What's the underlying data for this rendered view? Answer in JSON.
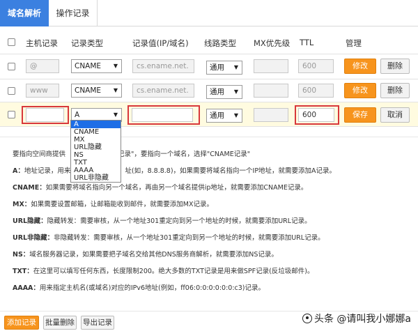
{
  "tabs": [
    {
      "label": "域名解析",
      "active": true
    },
    {
      "label": "操作记录",
      "active": false
    }
  ],
  "columns": {
    "host": "主机记录",
    "type": "记录类型",
    "value": "记录值(IP/域名)",
    "line": "线路类型",
    "mx": "MX优先级",
    "ttl": "TTL",
    "manage": "管理"
  },
  "rows": [
    {
      "host": "@",
      "type": "CNAME",
      "value": "cs.ename.net.",
      "line": "通用",
      "mx": "",
      "ttl": "600",
      "edit_label": "修改",
      "delete_label": "删除"
    },
    {
      "host": "www",
      "type": "CNAME",
      "value": "cs.ename.net.",
      "line": "通用",
      "mx": "",
      "ttl": "600",
      "edit_label": "修改",
      "delete_label": "删除"
    }
  ],
  "new_row": {
    "host": "",
    "type": "A",
    "value": "",
    "line": "通用",
    "mx": "",
    "ttl": "600",
    "save_label": "保存",
    "cancel_label": "取消"
  },
  "type_options": [
    "A",
    "CNAME",
    "MX",
    "URL隐藏",
    "NS",
    "TXT",
    "AAAA",
    "URL非隐藏"
  ],
  "help": {
    "intro": "要指向空间商提供",
    "intro_tail": "记录\"，要指向一个域名，选择\"CNAME记录\"",
    "items": [
      {
        "key": "A：",
        "text": "地址记录，用来",
        "tail": "址(如，8.8.8.8)，如果需要将域名指向一个IP地址，就需要添加A记录。"
      },
      {
        "key": "CNAME：",
        "text": "如果需要将域名指向另一个域名，再由另一个域名提供ip地址，就需要添加CNAME记录。"
      },
      {
        "key": "MX：",
        "text": "如果需要设置邮箱，让邮箱能收到邮件，就需要添加MX记录。"
      },
      {
        "key": "URL隐藏：",
        "text": "隐藏转发：需要审核，从一个地址301重定向到另一个地址的时候，就需要添加URL记录。"
      },
      {
        "key": "URL非隐藏：",
        "text": "非隐藏转发：需要审核，从一个地址301重定向到另一个地址的时候，就需要添加URL记录。"
      },
      {
        "key": "NS：",
        "text": "域名服务器记录，如果需要把子域名交给其他DNS服务商解析，就需要添加NS记录。"
      },
      {
        "key": "TXT：",
        "text": "在这里可以填写任何东西，长度限制200。绝大多数的TXT记录是用来做SPF记录(反垃圾邮件)。"
      },
      {
        "key": "AAAA：",
        "text": "用来指定主机名(或域名)对应的IPv6地址(例如，ff06:0:0:0:0:0:0:c3)记录。"
      }
    ]
  },
  "footer": {
    "add_label": "添加记录",
    "batch_delete_label": "批量删除",
    "export_label": "导出记录"
  },
  "watermark": "头条 @请叫我小娜娜a",
  "colors": {
    "tab_active": "#3b80e0",
    "orange_button": "#f7941d",
    "highlight_red": "#d8373a",
    "edit_row_bg": "#fffbe0",
    "option_selected": "#1e6ee6"
  }
}
